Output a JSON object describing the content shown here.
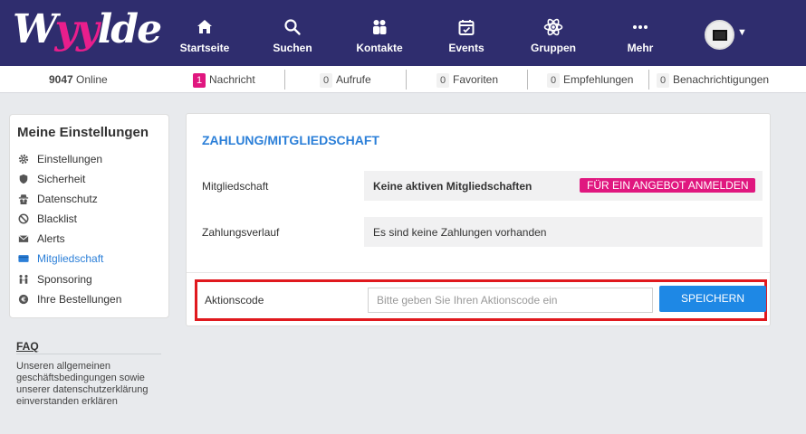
{
  "brand": {
    "logo_part1": "W",
    "logo_part2": "yy",
    "logo_part3": "lde",
    "accent": "#e91e8c",
    "header_bg": "#2f2d6e"
  },
  "nav": [
    {
      "label": "Startseite",
      "icon": "home-icon"
    },
    {
      "label": "Suchen",
      "icon": "search-icon"
    },
    {
      "label": "Kontakte",
      "icon": "contacts-icon"
    },
    {
      "label": "Events",
      "icon": "calendar-icon"
    },
    {
      "label": "Gruppen",
      "icon": "atom-icon"
    },
    {
      "label": "Mehr",
      "icon": "more-icon"
    }
  ],
  "stats": {
    "online_count": "9047",
    "online_label": "Online",
    "items": [
      {
        "count": "1",
        "label": "Nachricht"
      },
      {
        "count": "0",
        "label": "Aufrufe"
      },
      {
        "count": "0",
        "label": "Favoriten"
      },
      {
        "count": "0",
        "label": "Empfehlungen"
      },
      {
        "count": "0",
        "label": "Benachrichtigungen"
      }
    ]
  },
  "sidebar": {
    "title": "Meine Einstellungen",
    "items": [
      {
        "label": "Einstellungen",
        "icon": "gear-icon"
      },
      {
        "label": "Sicherheit",
        "icon": "shield-icon"
      },
      {
        "label": "Datenschutz",
        "icon": "spy-icon"
      },
      {
        "label": "Blacklist",
        "icon": "ban-icon"
      },
      {
        "label": "Alerts",
        "icon": "envelope-icon"
      },
      {
        "label": "Mitgliedschaft",
        "icon": "card-icon"
      },
      {
        "label": "Sponsoring",
        "icon": "people-icon"
      },
      {
        "label": "Ihre Bestellungen",
        "icon": "euro-icon"
      }
    ],
    "active": "Mitgliedschaft"
  },
  "faq": {
    "title": "FAQ",
    "text": "Unseren allgemeinen geschäftsbedingungen sowie unserer datenschutzerklärung einverstanden erklären"
  },
  "main": {
    "title": "ZAHLUNG/MITGLIEDSCHAFT",
    "membership_label": "Mitgliedschaft",
    "membership_value": "Keine aktiven Mitgliedschaften",
    "membership_button": "FÜR EIN ANGEBOT ANMELDEN",
    "history_label": "Zahlungsverlauf",
    "history_value": "Es sind keine Zahlungen vorhanden",
    "promo_label": "Aktionscode",
    "promo_placeholder": "Bitte geben Sie Ihren Aktionscode ein",
    "save_label": "SPEICHERN"
  }
}
